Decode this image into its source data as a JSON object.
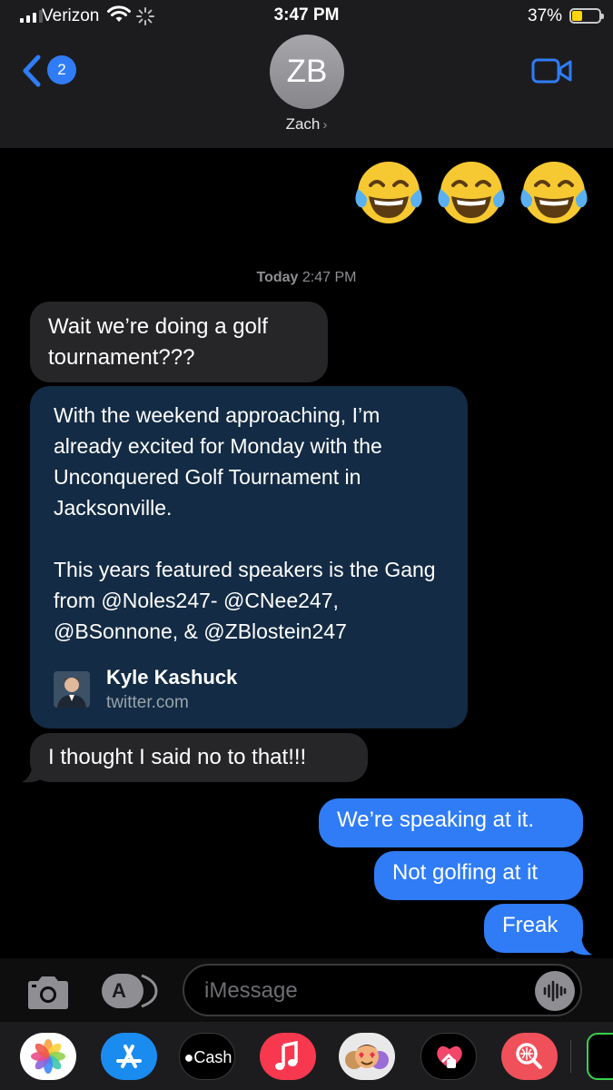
{
  "status_bar": {
    "carrier": "Verizon",
    "time": "3:47 PM",
    "battery": "37%",
    "battery_level": 0.37
  },
  "header": {
    "back_badge": "2",
    "avatar_initials": "ZB",
    "contact_name": "Zach",
    "contact_chevron": "›"
  },
  "conversation": {
    "top_emojis": [
      "😂",
      "😂",
      "😂"
    ],
    "timestamp_day": "Today",
    "timestamp_time": "2:47 PM",
    "messages": [
      {
        "direction": "in",
        "text": "Wait we’re doing a golf tournament???"
      },
      {
        "direction": "in",
        "text": "I thought I said no to that!!!"
      },
      {
        "direction": "out",
        "text": "We’re speaking at it."
      },
      {
        "direction": "out",
        "text": "Not golfing at it"
      },
      {
        "direction": "out",
        "text": "Freak"
      }
    ],
    "link_preview": {
      "text": "With the weekend approaching, I’m already excited for Monday with the Unconquered Golf Tournament in Jacksonville.\n\nThis years featured speakers is the Gang from @Noles247- @CNee247, @BSonnone, & @ZBlostein247",
      "author": "Kyle Kashuck",
      "domain": "twitter.com"
    }
  },
  "compose": {
    "placeholder": "iMessage"
  },
  "app_drawer": {
    "apps": [
      "photos",
      "app-store",
      "apple-cash",
      "music",
      "memoji",
      "digital-touch",
      "images-search",
      "more"
    ],
    "cash_label": "Cash"
  },
  "colors": {
    "header_bg": "#1c1c1e",
    "outgoing_bubble": "#2f7cf6",
    "incoming_bubble": "#262629",
    "link_card": "#132b44",
    "ios_blue": "#2f7cf6",
    "battery_yellow": "#ffd60a"
  },
  "icons": [
    "signal-bars-icon",
    "wifi-icon",
    "activity-spinner-icon",
    "battery-icon",
    "chevron-left-icon",
    "video-camera-icon",
    "camera-icon",
    "app-store-icon",
    "audio-waveform-icon"
  ]
}
